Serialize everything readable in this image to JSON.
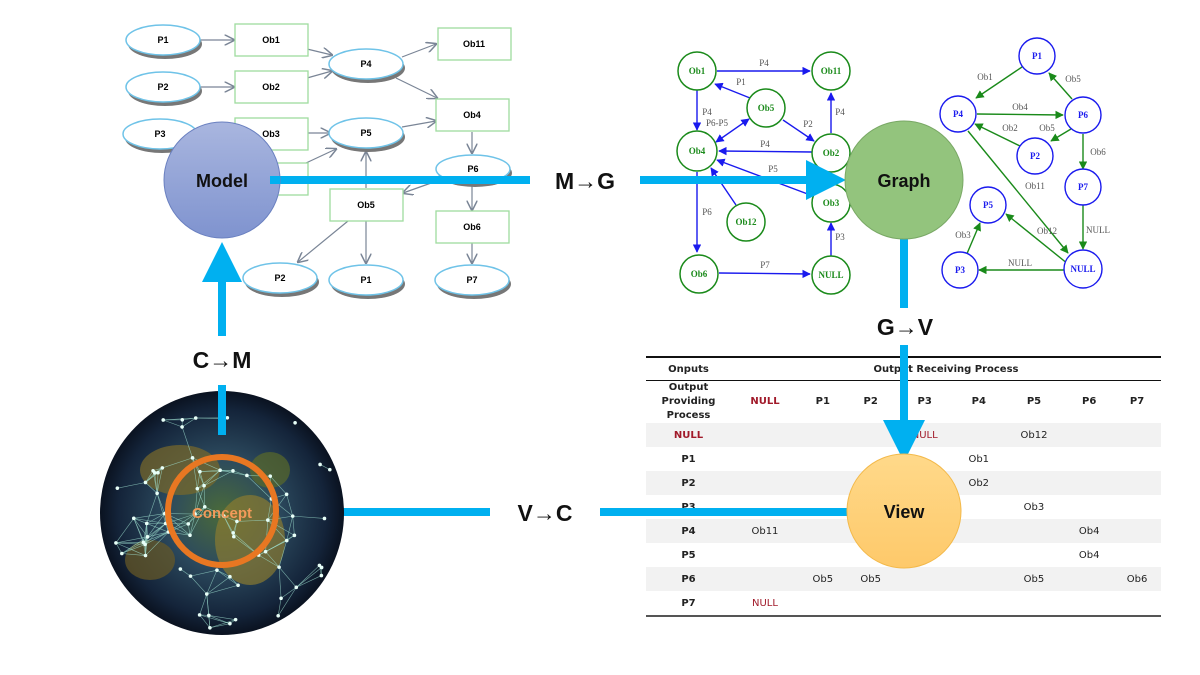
{
  "colors": {
    "flow_arrow": "#00b0f0",
    "model_fill": "#8fa4d6",
    "graph_fill": "#93c47d",
    "view_fill": "#ffd27f",
    "concept_ring": "#e87722",
    "object_node": "#1a8a1a",
    "process_node": "#1a1aee",
    "null_text": "#a11a2a"
  },
  "stages": {
    "model": "Model",
    "graph": "Graph",
    "view": "View",
    "concept": "Concept"
  },
  "transitions": {
    "m_to_g": "M→G",
    "g_to_v": "G→V",
    "v_to_c": "V→C",
    "c_to_m": "C→M"
  },
  "model_diagram": {
    "processes": [
      "P1",
      "P2",
      "P3",
      "P4",
      "P5",
      "P6",
      "P2",
      "P1",
      "P7"
    ],
    "objects": [
      "Ob1",
      "Ob2",
      "Ob3",
      "Ob11",
      "Ob4",
      "Ob5",
      "Ob6"
    ]
  },
  "object_graph": {
    "nodes": [
      "Ob1",
      "Ob11",
      "Ob5",
      "Ob4",
      "Ob2",
      "Ob3",
      "Ob12",
      "Ob6",
      "NULL"
    ],
    "edges": [
      {
        "from": "Ob1",
        "to": "Ob11",
        "label": "P4"
      },
      {
        "from": "Ob5",
        "to": "Ob1",
        "label": "P1"
      },
      {
        "from": "Ob1",
        "to": "Ob4",
        "label": "P4"
      },
      {
        "from": "Ob5",
        "to": "Ob4",
        "label": "P6-P5"
      },
      {
        "from": "Ob5",
        "to": "Ob2",
        "label": "P2"
      },
      {
        "from": "Ob2",
        "to": "Ob11",
        "label": "P4"
      },
      {
        "from": "Ob2",
        "to": "Ob4",
        "label": "P4"
      },
      {
        "from": "Ob3",
        "to": "Ob4",
        "label": "P5"
      },
      {
        "from": "Ob12",
        "to": "Ob4",
        "label": "P5"
      },
      {
        "from": "Ob4",
        "to": "Ob6",
        "label": "P6"
      },
      {
        "from": "Ob6",
        "to": "NULL",
        "label": "P7"
      },
      {
        "from": "NULL",
        "to": "Ob3",
        "label": "P3"
      }
    ]
  },
  "process_graph": {
    "nodes": [
      "P1",
      "P4",
      "P6",
      "P2",
      "P7",
      "P5",
      "P3",
      "NULL"
    ],
    "edges": [
      {
        "from": "P1",
        "to": "P4",
        "label": "Ob1"
      },
      {
        "from": "P6",
        "to": "P1",
        "label": "Ob5"
      },
      {
        "from": "P4",
        "to": "P6",
        "label": "Ob4"
      },
      {
        "from": "P2",
        "to": "P4",
        "label": "Ob2"
      },
      {
        "from": "P6",
        "to": "P2",
        "label": "Ob5"
      },
      {
        "from": "P6",
        "to": "P7",
        "label": "Ob6"
      },
      {
        "from": "P4",
        "to": "NULL",
        "label": "Ob11"
      },
      {
        "from": "NULL",
        "to": "P5",
        "label": "Ob12"
      },
      {
        "from": "P7",
        "to": "NULL",
        "label": "NULL"
      },
      {
        "from": "NULL",
        "to": "P3",
        "label": "NULL"
      },
      {
        "from": "P3",
        "to": "P5",
        "label": "Ob3"
      }
    ]
  },
  "view_table": {
    "corner_label": "Onputs",
    "group_label": "Output Receiving Process",
    "row_header_label": "Output Providing Process",
    "columns": [
      "NULL",
      "P1",
      "P2",
      "P3",
      "P4",
      "P5",
      "P6",
      "P7"
    ],
    "rows": [
      {
        "name": "NULL",
        "cells": [
          "",
          "",
          "",
          "NULL",
          "",
          "Ob12",
          "",
          ""
        ]
      },
      {
        "name": "P1",
        "cells": [
          "",
          "",
          "",
          "",
          "Ob1",
          "",
          "",
          ""
        ]
      },
      {
        "name": "P2",
        "cells": [
          "",
          "",
          "",
          "",
          "Ob2",
          "",
          "",
          ""
        ]
      },
      {
        "name": "P3",
        "cells": [
          "",
          "",
          "",
          "",
          "",
          "Ob3",
          "",
          ""
        ]
      },
      {
        "name": "P4",
        "cells": [
          "Ob11",
          "",
          "",
          "",
          "",
          "",
          "Ob4",
          ""
        ]
      },
      {
        "name": "P5",
        "cells": [
          "",
          "",
          "",
          "",
          "",
          "",
          "Ob4",
          ""
        ]
      },
      {
        "name": "P6",
        "cells": [
          "",
          "Ob5",
          "Ob5",
          "",
          "",
          "Ob5",
          "",
          "Ob6"
        ]
      },
      {
        "name": "P7",
        "cells": [
          "NULL",
          "",
          "",
          "",
          "",
          "",
          "",
          ""
        ]
      }
    ]
  }
}
